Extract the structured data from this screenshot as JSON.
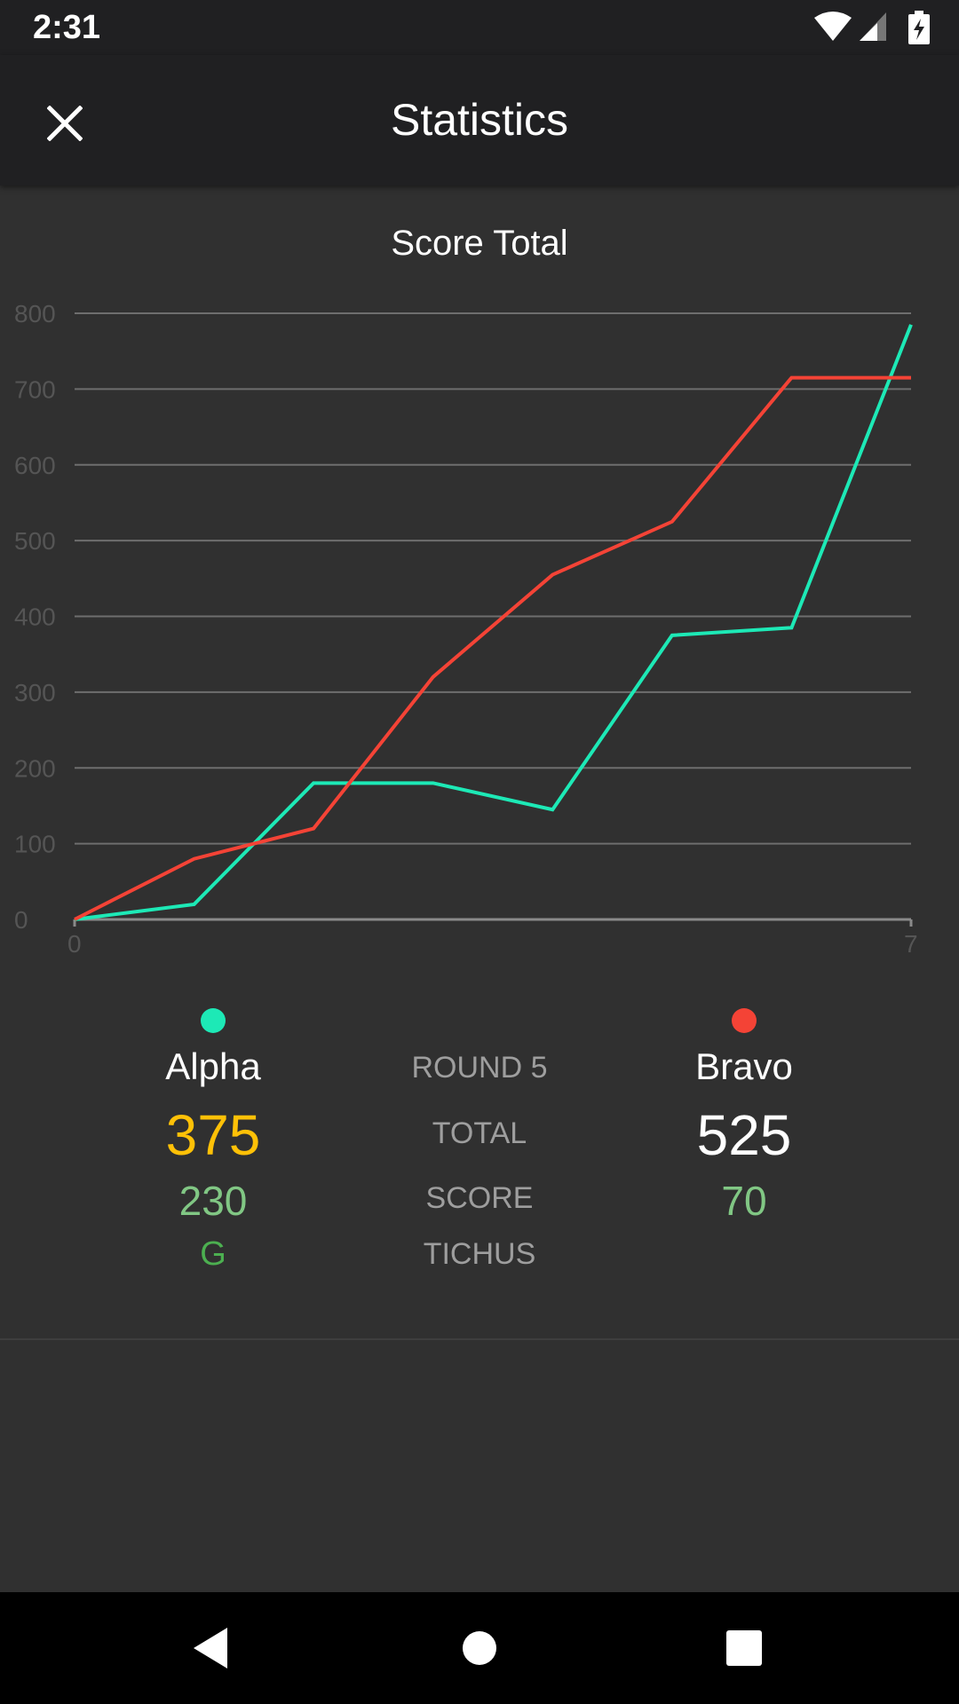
{
  "status_bar": {
    "time": "2:31",
    "icons": [
      "wifi-icon",
      "signal-icon",
      "battery-charging-icon"
    ]
  },
  "app_bar": {
    "title": "Statistics",
    "close_icon": "close-icon"
  },
  "chart_data": {
    "type": "line",
    "title": "Score Total",
    "xlabel": "",
    "ylabel": "",
    "x": [
      0,
      1,
      2,
      3,
      4,
      5,
      6,
      7
    ],
    "xlim": [
      0,
      7
    ],
    "ylim": [
      0,
      800
    ],
    "x_ticks": [
      "0",
      "7"
    ],
    "y_ticks": [
      "0",
      "100",
      "200",
      "300",
      "400",
      "500",
      "600",
      "700",
      "800"
    ],
    "grid": true,
    "series": [
      {
        "color": "#1de9b6",
        "values": [
          0,
          20,
          180,
          180,
          145,
          375,
          385,
          785
        ]
      },
      {
        "color": "#f44336",
        "values": [
          0,
          80,
          120,
          320,
          455,
          525,
          715,
          715
        ]
      }
    ]
  },
  "summary": {
    "round_label": "ROUND 5",
    "total_label": "TOTAL",
    "score_label": "SCORE",
    "tichus_label": "TICHUS",
    "team_a": {
      "name": "Alpha",
      "color": "#1de9b6",
      "total": "375",
      "total_color": "#ffc107",
      "score": "230",
      "tichu": "G"
    },
    "team_b": {
      "name": "Bravo",
      "color": "#f44336",
      "total": "525",
      "total_color": "#ffffff",
      "score": "70",
      "tichu": ""
    }
  },
  "nav_bar": {
    "icons": [
      "back-icon",
      "home-icon",
      "recents-icon"
    ]
  }
}
